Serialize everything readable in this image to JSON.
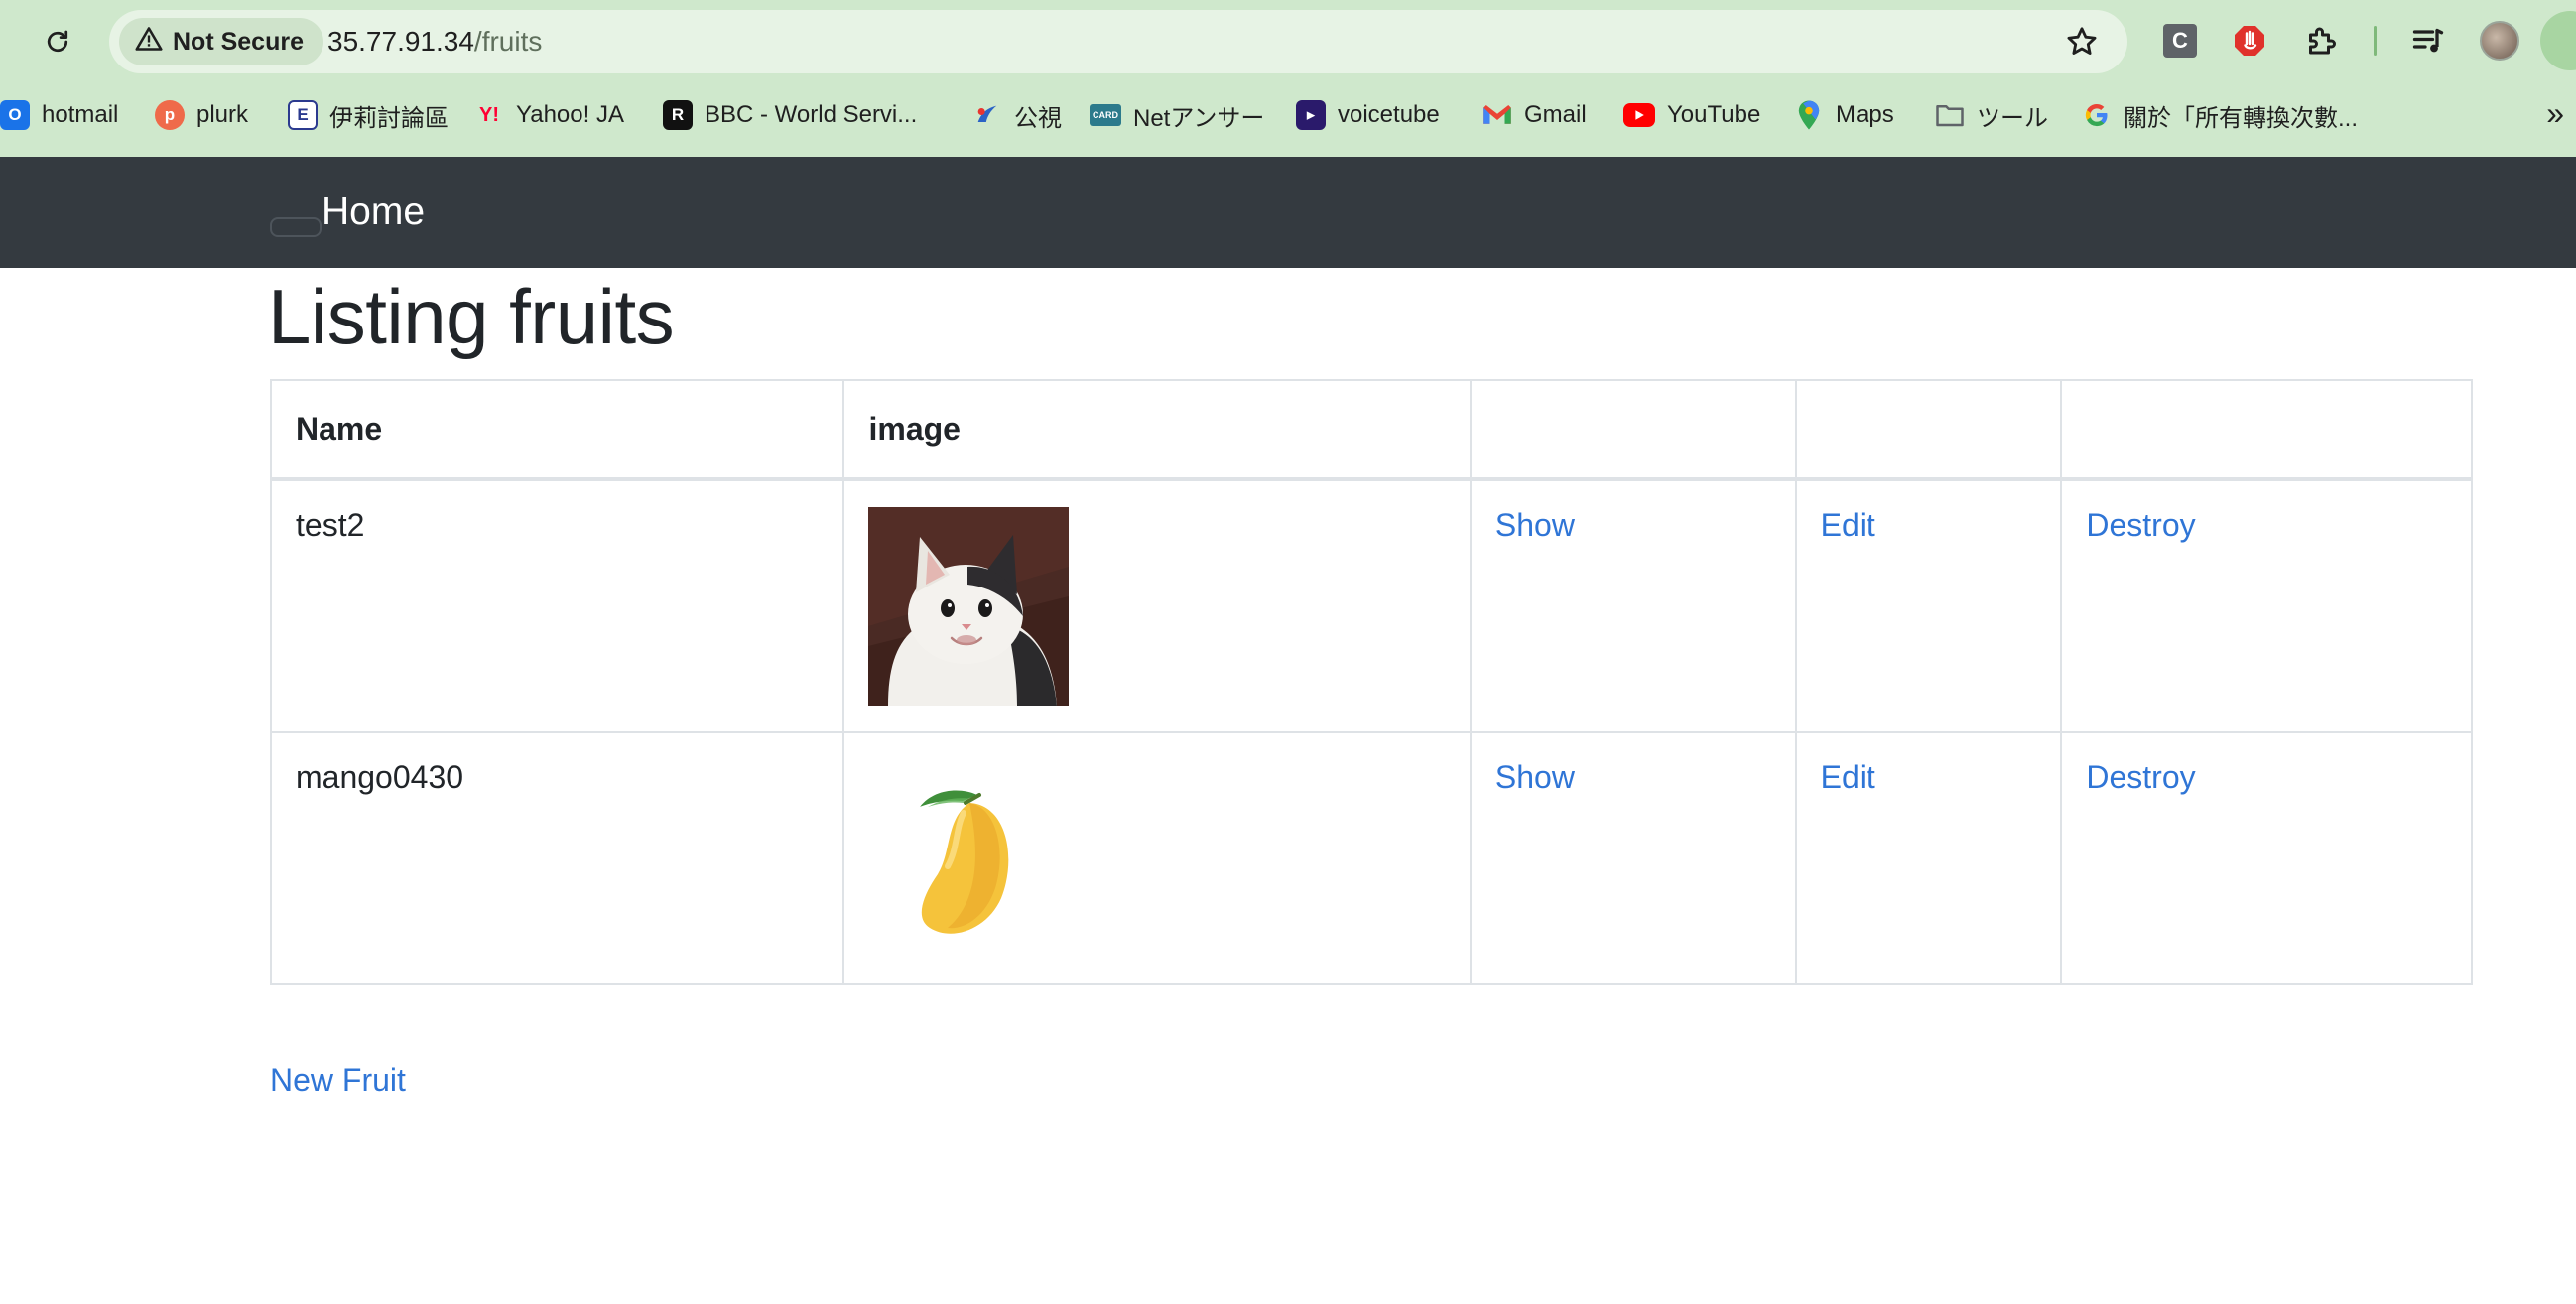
{
  "browser": {
    "security_label": "Not Secure",
    "url_host": "35.77.91.34",
    "url_path": "/fruits",
    "bookmarks": [
      {
        "label": "hotmail",
        "icon": "outlook-icon",
        "color": "#1a73e8"
      },
      {
        "label": "plurk",
        "icon": "plurk-icon",
        "color": "#ef6a4a"
      },
      {
        "label": "伊莉討論區",
        "icon": "eyny-icon",
        "color": "#2b3a8f"
      },
      {
        "label": "Yahoo! JA",
        "icon": "yahoo-icon",
        "color": "#ff0033"
      },
      {
        "label": "BBC - World Servi...",
        "icon": "bbc-icon",
        "color": "#111111"
      },
      {
        "label": "公視",
        "icon": "pts-icon",
        "color": "#2a63c6"
      },
      {
        "label": "Netアンサー",
        "icon": "saison-card-icon",
        "color": "#2c7a8c"
      },
      {
        "label": "voicetube",
        "icon": "voicetube-icon",
        "color": "#2a1a6b"
      },
      {
        "label": "Gmail",
        "icon": "gmail-icon",
        "color": "#ea4335"
      },
      {
        "label": "YouTube",
        "icon": "youtube-icon",
        "color": "#ff0000"
      },
      {
        "label": "Maps",
        "icon": "maps-icon",
        "color": "#34a853"
      },
      {
        "label": "ツール",
        "icon": "folder-icon",
        "color": "#5f6368"
      },
      {
        "label": "關於「所有轉換次數...",
        "icon": "google-icon",
        "color": "#4285f4"
      }
    ]
  },
  "nav": {
    "home_label": "Home"
  },
  "main": {
    "title": "Listing fruits",
    "table": {
      "headers": [
        "Name",
        "image",
        "",
        "",
        ""
      ],
      "rows": [
        {
          "name": "test2",
          "image": "cat-photo",
          "show": "Show",
          "edit": "Edit",
          "destroy": "Destroy"
        },
        {
          "name": "mango0430",
          "image": "mango-image",
          "show": "Show",
          "edit": "Edit",
          "destroy": "Destroy"
        }
      ]
    },
    "new_link": "New Fruit"
  },
  "colors": {
    "chrome_bg": "#cfe8cc",
    "navbar_bg": "#343a40",
    "link": "#2f75d6",
    "text": "#212529"
  }
}
